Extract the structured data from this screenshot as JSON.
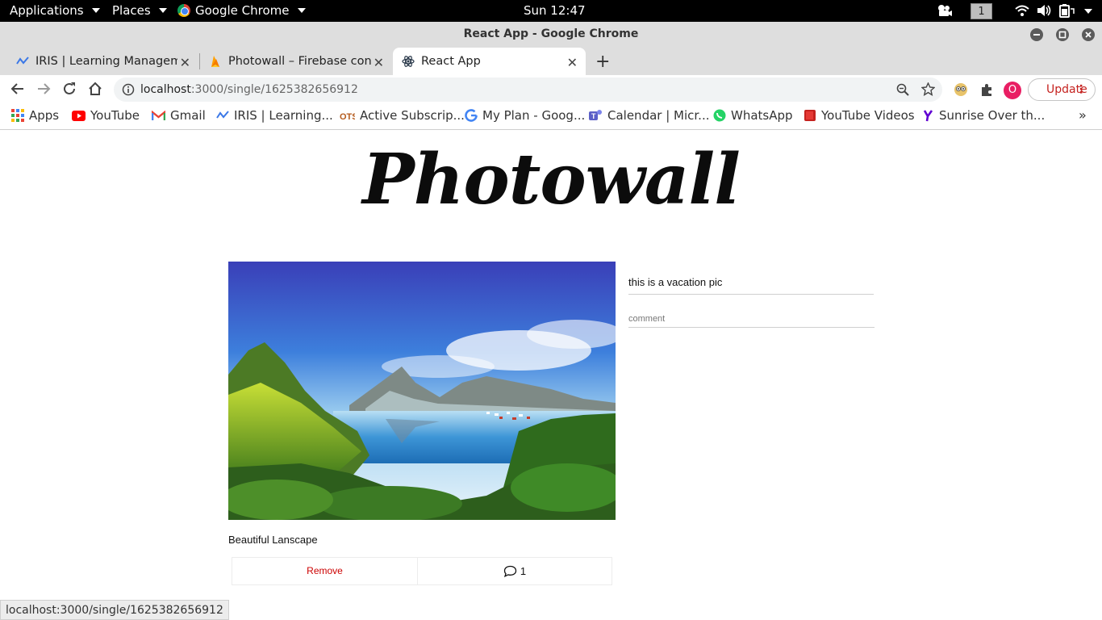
{
  "system_bar": {
    "applications_label": "Applications",
    "places_label": "Places",
    "app_label": "Google Chrome",
    "clock": "Sun 12:47",
    "workspace": "1"
  },
  "window": {
    "title": "React App - Google Chrome"
  },
  "tabs": [
    {
      "label": "IRIS | Learning Manageme",
      "favicon": "iris-icon"
    },
    {
      "label": "Photowall – Firebase cons",
      "favicon": "firebase-icon"
    },
    {
      "label": "React App",
      "favicon": "react-icon",
      "active": true
    }
  ],
  "toolbar": {
    "url_host": "localhost",
    "url_path": ":3000/single/1625382656912",
    "update_label": "Update",
    "profile_initial": "O"
  },
  "bookmarks": [
    {
      "label": "Apps",
      "icon": "apps-grid-icon"
    },
    {
      "label": "YouTube",
      "icon": "youtube-icon"
    },
    {
      "label": "Gmail",
      "icon": "gmail-icon"
    },
    {
      "label": "IRIS | Learning...",
      "icon": "iris-icon"
    },
    {
      "label": "Active Subscrip...",
      "icon": "ots-icon"
    },
    {
      "label": "My Plan - Goog...",
      "icon": "google-icon"
    },
    {
      "label": "Calendar | Micr...",
      "icon": "teams-icon"
    },
    {
      "label": "WhatsApp",
      "icon": "whatsapp-icon"
    },
    {
      "label": "YouTube Videos",
      "icon": "book-icon"
    },
    {
      "label": "Sunrise Over th...",
      "icon": "yahoo-icon"
    }
  ],
  "page": {
    "logo": "Photowall",
    "photo_alt": "Beautiful Lanscape",
    "caption": "Beautiful Lanscape",
    "remove_label": "Remove",
    "comment_count": "1",
    "comments": [
      "this is a vacation pic"
    ],
    "comment_placeholder": "comment"
  },
  "status_url": "localhost:3000/single/1625382656912",
  "colors": {
    "remove_red": "#cc0000",
    "update_red": "#c5221f",
    "avatar_pink": "#e91e63"
  }
}
